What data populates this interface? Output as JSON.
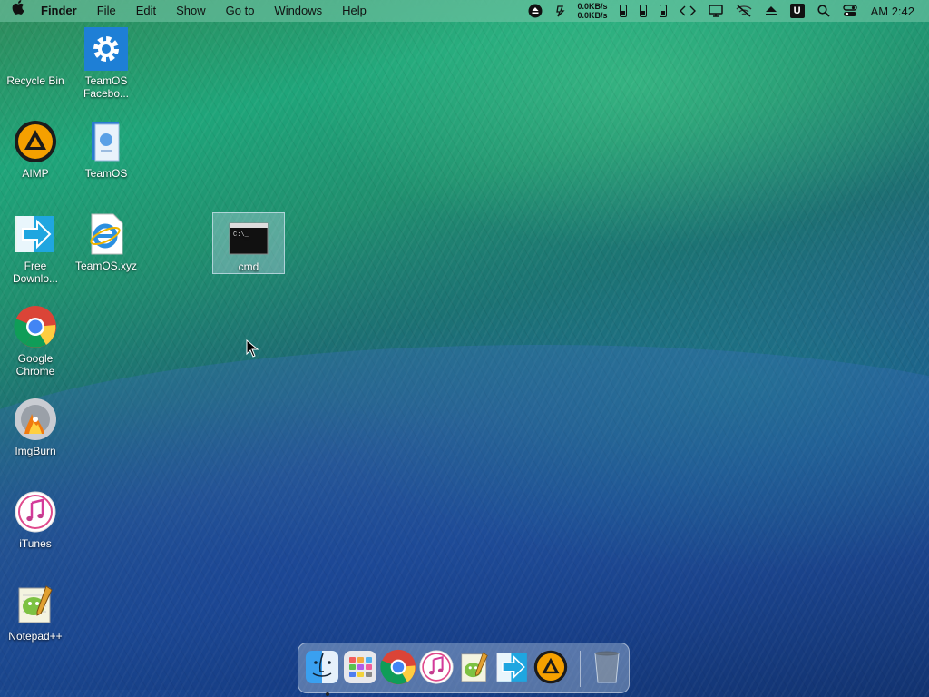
{
  "menubar": {
    "app_name": "Finder",
    "menus": [
      "File",
      "Edit",
      "Show",
      "Go to",
      "Windows",
      "Help"
    ],
    "net_up": "0.0KB/s",
    "net_down": "0.0KB/s",
    "clock": "AM 2:42",
    "status_icons": [
      "eject-circle-icon",
      "sync-icon",
      "battery-c-icon",
      "battery-m-icon",
      "battery-g-icon",
      "code-icon",
      "display-icon",
      "wifi-off-icon",
      "eject-icon",
      "u-app-icon",
      "search-icon",
      "control-center-icon"
    ],
    "u_letter": "U"
  },
  "desktop": {
    "icons": [
      {
        "label": "Recycle Bin"
      },
      {
        "label": "TeamOS Facebo..."
      },
      {
        "label": "AIMP"
      },
      {
        "label": "TeamOS"
      },
      {
        "label": "Free Downlo..."
      },
      {
        "label": "TeamOS.xyz"
      },
      {
        "label": "cmd"
      },
      {
        "label": "Google Chrome"
      },
      {
        "label": "ImgBurn"
      },
      {
        "label": "iTunes"
      },
      {
        "label": "Notepad++"
      }
    ],
    "cmd_prompt": "C:\\_"
  },
  "dock": {
    "items": [
      "finder",
      "launchpad",
      "chrome",
      "itunes",
      "notepad++",
      "free-download-manager",
      "aimp",
      "trash"
    ]
  }
}
